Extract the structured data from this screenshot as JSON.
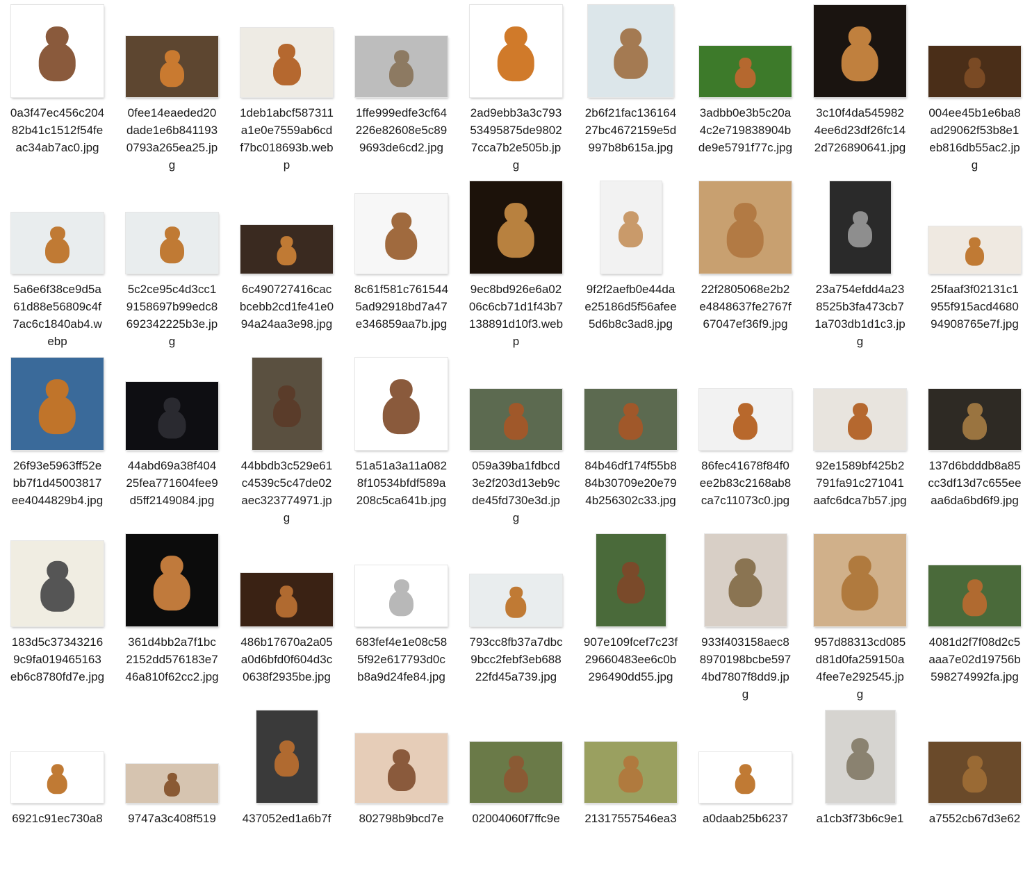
{
  "window": {
    "title": ""
  },
  "files": [
    {
      "name": "0a3f47ec456c20482b41c1512f54feac34ab7ac0.jpg",
      "w": 133,
      "h": 133,
      "bg": "#ffffff",
      "fg": "#8a5a3c"
    },
    {
      "name": "0fee14eaeded20dade1e6b8411930793a265ea25.jpg",
      "w": 133,
      "h": 88,
      "bg": "#5d4630",
      "fg": "#c97a30"
    },
    {
      "name": "1deb1abcf587311a1e0e7559ab6cdf7bc018693b.webp",
      "w": 133,
      "h": 100,
      "bg": "#eeebe4",
      "fg": "#b5682f"
    },
    {
      "name": "1ffe999edfe3cf64226e82608e5c899693de6cd2.jpg",
      "w": 133,
      "h": 88,
      "bg": "#bdbdbd",
      "fg": "#8d7a62"
    },
    {
      "name": "2ad9ebb3a3c79353495875de98027cca7b2e505b.jpg",
      "w": 133,
      "h": 133,
      "bg": "#ffffff",
      "fg": "#d07a2a"
    },
    {
      "name": "2b6f21fac13616427bc4672159e5d997b8b615a.jpg",
      "w": 123,
      "h": 133,
      "bg": "#dce6ea",
      "fg": "#a47a52"
    },
    {
      "name": "3adbb0e3b5c20a4c2e719838904bde9e5791f77c.jpg",
      "w": 133,
      "h": 74,
      "bg": "#3d7a2a",
      "fg": "#b5682f"
    },
    {
      "name": "3c10f4da5459824ee6d23df26fc142d726890641.jpg",
      "w": 133,
      "h": 133,
      "bg": "#1a1410",
      "fg": "#c0803e"
    },
    {
      "name": "004ee45b1e6ba8ad29062f53b8e1eb816db55ac2.jpg",
      "w": 133,
      "h": 74,
      "bg": "#4a2e18",
      "fg": "#7a4a24"
    },
    {
      "name": "5a6e6f38ce9d5a61d88e56809c4f7ac6c1840ab4.webp",
      "w": 133,
      "h": 88,
      "bg": "#e9edee",
      "fg": "#c07a34"
    },
    {
      "name": "5c2ce95c4d3cc19158697b99edc8692342225b3e.jpg",
      "w": 133,
      "h": 88,
      "bg": "#e9edee",
      "fg": "#c07a34"
    },
    {
      "name": "6c490727416cacbcebb2cd1fe41e094a24aa3e98.jpg",
      "w": 133,
      "h": 70,
      "bg": "#3a2a20",
      "fg": "#c07a34"
    },
    {
      "name": "8c61f581c7615445ad92918bd7a47e346859aa7b.jpg",
      "w": 133,
      "h": 115,
      "bg": "#f7f7f7",
      "fg": "#a06a3e"
    },
    {
      "name": "9ec8bd926e6a0206c6cb71d1f43b7138891d10f3.webp",
      "w": 133,
      "h": 133,
      "bg": "#1c120a",
      "fg": "#b8813f"
    },
    {
      "name": "9f2f2aefb0e44dae25186d5f56afee5d6b8c3ad8.jpg",
      "w": 88,
      "h": 133,
      "bg": "#f2f2f2",
      "fg": "#c99a6a"
    },
    {
      "name": "22f2805068e2b2e4848637fe2767f67047ef36f9.jpg",
      "w": 133,
      "h": 133,
      "bg": "#c8a070",
      "fg": "#b27a44"
    },
    {
      "name": "23a754efdd4a238525b3fa473cb71a703db1d1c3.jpg",
      "w": 88,
      "h": 133,
      "bg": "#2a2a2a",
      "fg": "#8e8e8e"
    },
    {
      "name": "25faaf3f02131c1955f915acd468094908765e7f.jpg",
      "w": 133,
      "h": 68,
      "bg": "#efe9e1",
      "fg": "#c07a34"
    },
    {
      "name": "26f93e5963ff52ebb7f1d45003817ee4044829b4.jpg",
      "w": 133,
      "h": 133,
      "bg": "#3a6a9a",
      "fg": "#c0742a"
    },
    {
      "name": "44abd69a38f40425fea771604fee9d5ff2149084.jpg",
      "w": 133,
      "h": 98,
      "bg": "#0e0e12",
      "fg": "#2a2a30"
    },
    {
      "name": "44bbdb3c529e61c4539c5c47de02aec323774971.jpg",
      "w": 100,
      "h": 133,
      "bg": "#5a5040",
      "fg": "#5a3c2a"
    },
    {
      "name": "51a51a3a11a0828f10534bfdf589a208c5ca641b.jpg",
      "w": 133,
      "h": 133,
      "bg": "#ffffff",
      "fg": "#8a5a3c"
    },
    {
      "name": "059a39ba1fdbcd3e2f203d13eb9cde45fd730e3d.jpg",
      "w": 133,
      "h": 88,
      "bg": "#5c6a50",
      "fg": "#a0582a"
    },
    {
      "name": "84b46df174f55b884b30709e20e794b256302c33.jpg",
      "w": 133,
      "h": 88,
      "bg": "#5c6a50",
      "fg": "#a0582a"
    },
    {
      "name": "86fec41678f84f0ee2b83c2168ab8ca7c11073c0.jpg",
      "w": 133,
      "h": 88,
      "bg": "#f2f2f2",
      "fg": "#b8682c"
    },
    {
      "name": "92e1589bf425b2791fa91c271041aafc6dca7b57.jpg",
      "w": 133,
      "h": 88,
      "bg": "#e8e4de",
      "fg": "#b5682f"
    },
    {
      "name": "137d6bdddb8a85cc3df13d7c655eeaa6da6bd6f9.jpg",
      "w": 133,
      "h": 88,
      "bg": "#2e2a24",
      "fg": "#9a7440"
    },
    {
      "name": "183d5c373432169c9fa019465163eb6c8780fd7e.jpg",
      "w": 133,
      "h": 123,
      "bg": "#f0ede2",
      "fg": "#555555"
    },
    {
      "name": "361d4bb2a7f1bc2152dd576183e746a810f62cc2.jpg",
      "w": 133,
      "h": 133,
      "bg": "#0c0c0c",
      "fg": "#c07a3c"
    },
    {
      "name": "486b17670a2a05a0d6bfd0f604d3c0638f2935be.jpg",
      "w": 133,
      "h": 77,
      "bg": "#3a2214",
      "fg": "#b06a30"
    },
    {
      "name": "683fef4e1e08c585f92e617793d0cb8a9d24fe84.jpg",
      "w": 133,
      "h": 88,
      "bg": "#ffffff",
      "fg": "#b8b8b8"
    },
    {
      "name": "793cc8fb37a7dbc9bcc2febf3eb68822fd45a739.jpg",
      "w": 133,
      "h": 75,
      "bg": "#e9edee",
      "fg": "#c07a34"
    },
    {
      "name": "907e109fcef7c23f29660483ee6c0b296490dd55.jpg",
      "w": 100,
      "h": 133,
      "bg": "#4a6a3a",
      "fg": "#7a4a2a"
    },
    {
      "name": "933f403158aec88970198bcbe5974bd7807f8dd9.jpg",
      "w": 118,
      "h": 133,
      "bg": "#d8cfc6",
      "fg": "#8a7452"
    },
    {
      "name": "957d88313cd085d81d0fa259150a4fee7e292545.jpg",
      "w": 133,
      "h": 133,
      "bg": "#d0b08a",
      "fg": "#b07a3e"
    },
    {
      "name": "4081d2f7f08d2c5aaa7e02d19756b598274992fa.jpg",
      "w": 133,
      "h": 88,
      "bg": "#4a6a3a",
      "fg": "#b06a30"
    },
    {
      "name": "6921c91ec730a8",
      "w": 133,
      "h": 73,
      "bg": "#ffffff",
      "fg": "#c07a34"
    },
    {
      "name": "9747a3c408f519",
      "w": 133,
      "h": 56,
      "bg": "#d6c4b0",
      "fg": "#8a5a34"
    },
    {
      "name": "437052ed1a6b7f",
      "w": 88,
      "h": 133,
      "bg": "#3a3a3a",
      "fg": "#b06a30"
    },
    {
      "name": "802798b9bcd7e",
      "w": 133,
      "h": 100,
      "bg": "#e6cdb8",
      "fg": "#8a5a3c"
    },
    {
      "name": "02004060f7ffc9e",
      "w": 133,
      "h": 88,
      "bg": "#6a7a48",
      "fg": "#8a5a34"
    },
    {
      "name": "21317557546ea3",
      "w": 133,
      "h": 88,
      "bg": "#9aa060",
      "fg": "#b07a3e"
    },
    {
      "name": "a0daab25b6237",
      "w": 133,
      "h": 73,
      "bg": "#ffffff",
      "fg": "#c07a34"
    },
    {
      "name": "a1cb3f73b6c9e1",
      "w": 100,
      "h": 133,
      "bg": "#d6d4d0",
      "fg": "#8a8270"
    },
    {
      "name": "a7552cb67d3e62",
      "w": 133,
      "h": 88,
      "bg": "#6a4a2a",
      "fg": "#9a6a34"
    }
  ]
}
